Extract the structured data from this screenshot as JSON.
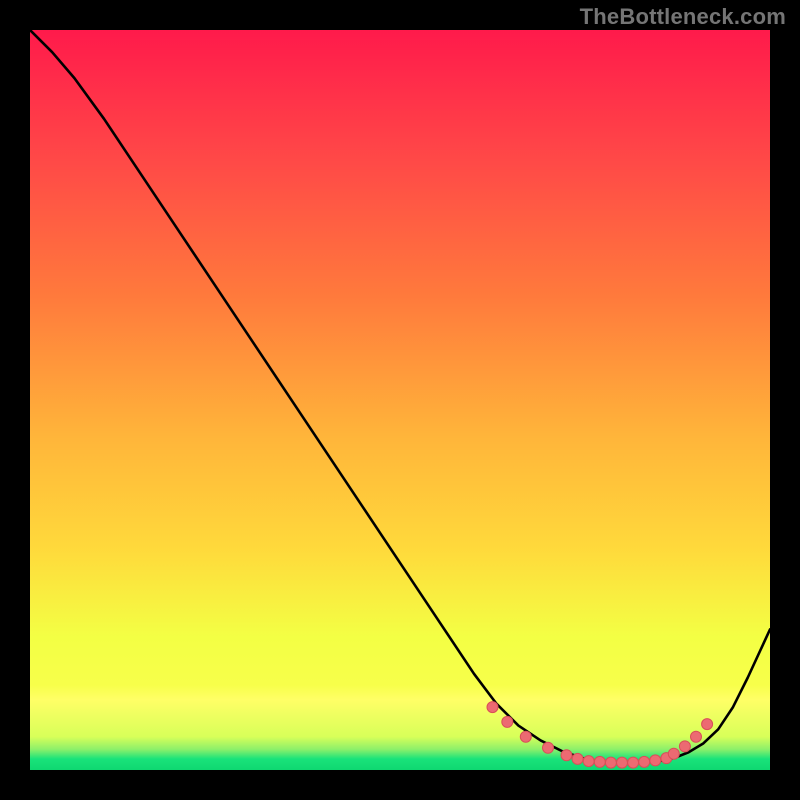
{
  "watermark": "TheBottleneck.com",
  "colors": {
    "gradient_top": "#ff1a4b",
    "gradient_mid_upper": "#ff7a3c",
    "gradient_mid": "#ffd93b",
    "gradient_lower": "#f7ff4a",
    "gradient_yellow_band": "#ffff66",
    "gradient_green": "#19e37a",
    "curve": "#000000",
    "marker_fill": "#ec6a72",
    "marker_stroke": "#d94f58"
  },
  "chart_data": {
    "type": "line",
    "title": "",
    "xlabel": "",
    "ylabel": "",
    "xlim": [
      0,
      100
    ],
    "ylim": [
      0,
      100
    ],
    "series": [
      {
        "name": "bottleneck-curve",
        "x": [
          0,
          3,
          6,
          10,
          15,
          20,
          25,
          30,
          35,
          40,
          45,
          50,
          55,
          60,
          63,
          66,
          69,
          72,
          75,
          78,
          81,
          83,
          85,
          87,
          89,
          91,
          93,
          95,
          97,
          100
        ],
        "y": [
          100,
          97,
          93.5,
          88,
          80.5,
          73,
          65.5,
          58,
          50.5,
          43,
          35.5,
          28,
          20.5,
          13,
          9,
          6,
          4,
          2.5,
          1.5,
          1,
          1,
          1,
          1.2,
          1.6,
          2.4,
          3.6,
          5.5,
          8.5,
          12.5,
          19
        ]
      }
    ],
    "markers": {
      "name": "highlight-dots",
      "x": [
        62.5,
        64.5,
        67,
        70,
        72.5,
        74,
        75.5,
        77,
        78.5,
        80,
        81.5,
        83,
        84.5,
        86,
        87,
        88.5,
        90,
        91.5
      ],
      "y": [
        8.5,
        6.5,
        4.5,
        3,
        2,
        1.5,
        1.2,
        1.1,
        1,
        1,
        1,
        1.1,
        1.3,
        1.6,
        2.2,
        3.2,
        4.5,
        6.2
      ]
    }
  }
}
